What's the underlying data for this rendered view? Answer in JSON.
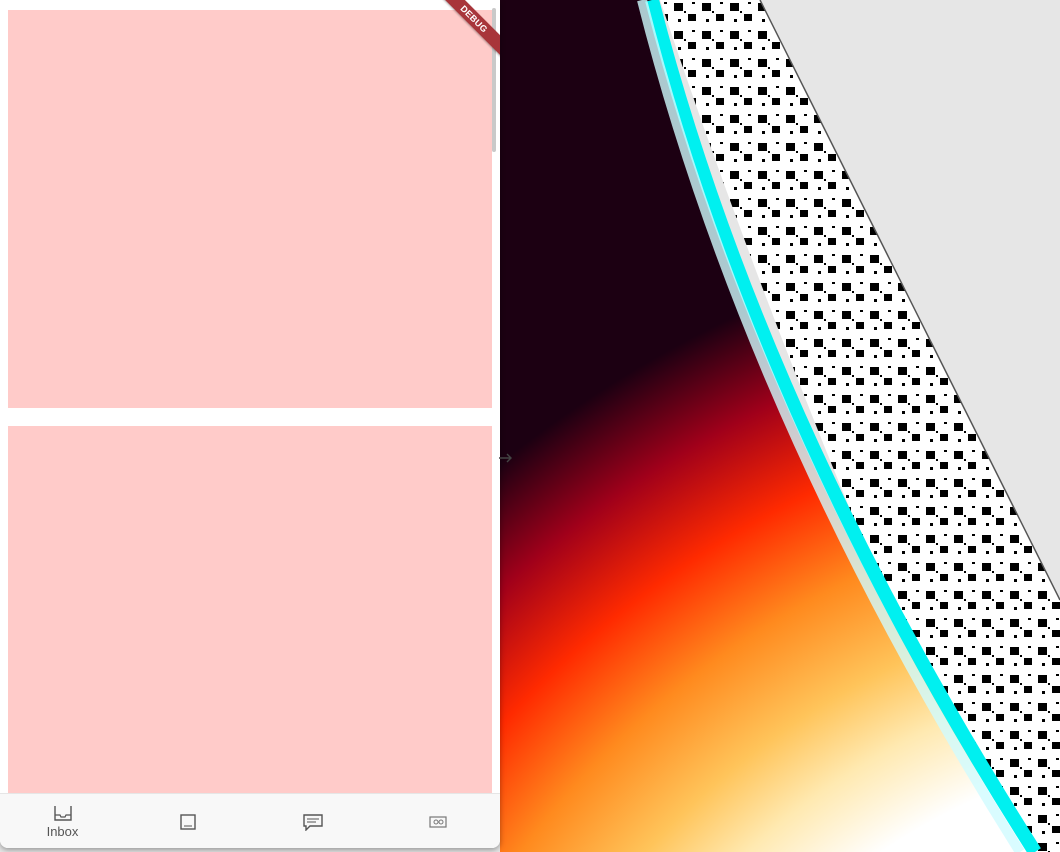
{
  "debug_banner": {
    "label": "DEBUG"
  },
  "bottom_nav": {
    "items": [
      {
        "label": "Inbox",
        "icon": "inbox-icon",
        "selected": true
      },
      {
        "label": "",
        "icon": "crop-square-icon"
      },
      {
        "label": "",
        "icon": "chat-icon"
      },
      {
        "label": "",
        "icon": "photo-icon"
      }
    ]
  },
  "colors": {
    "card_fill": "#ffcbc9",
    "gradient_dark": "#2a0010",
    "gradient_red": "#ff0000",
    "gradient_orange": "#ff7a1a",
    "gradient_yellow": "#ffd36a",
    "gradient_cyan": "#00eeee",
    "panel_gray": "#e6e6e6",
    "debug_ribbon": "#a8353a"
  }
}
